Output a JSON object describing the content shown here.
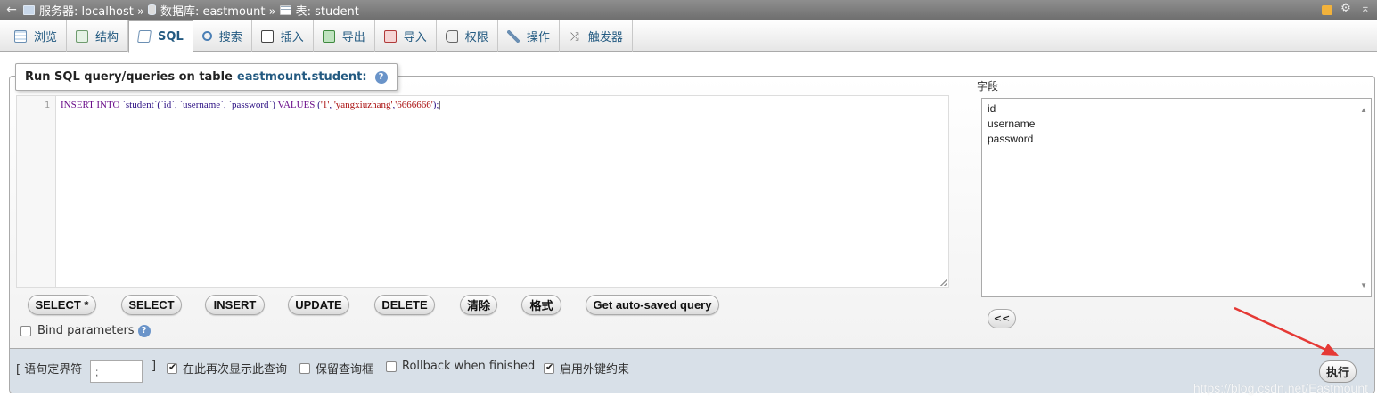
{
  "breadcrumb": {
    "back_symbol": "←",
    "server_label": "服务器: localhost »",
    "database_label": "数据库: eastmount »",
    "table_label": "表: student"
  },
  "tabs": [
    {
      "label": "浏览",
      "icon": "browse-icon"
    },
    {
      "label": "结构",
      "icon": "structure-icon"
    },
    {
      "label": "SQL",
      "icon": "sql-icon",
      "active": true
    },
    {
      "label": "搜索",
      "icon": "search-icon"
    },
    {
      "label": "插入",
      "icon": "insert-icon"
    },
    {
      "label": "导出",
      "icon": "export-icon"
    },
    {
      "label": "导入",
      "icon": "import-icon"
    },
    {
      "label": "权限",
      "icon": "privileges-icon"
    },
    {
      "label": "操作",
      "icon": "operations-icon"
    },
    {
      "label": "触发器",
      "icon": "triggers-icon"
    }
  ],
  "query_panel": {
    "title_prefix": "Run SQL query/queries on table",
    "table_name": "eastmount.student:",
    "line_number": "1",
    "sql_keyword_1": "INSERT INTO",
    "sql_part_1": " `student`(`id`, `username`, `password`) ",
    "sql_keyword_2": "VALUES",
    "sql_part_2": " (",
    "sql_str_1": "'1'",
    "sql_part_3": ", ",
    "sql_str_2": "'yangxiuzhang'",
    "sql_part_4": ",",
    "sql_str_3": "'6666666'",
    "sql_part_5": ");"
  },
  "fields": {
    "label": "字段",
    "items": [
      "id",
      "username",
      "password"
    ],
    "move_button": "<<"
  },
  "buttons": {
    "select_star": "SELECT *",
    "select": "SELECT",
    "insert": "INSERT",
    "update": "UPDATE",
    "delete": "DELETE",
    "clear": "清除",
    "format": "格式",
    "get_autosaved": "Get auto-saved query"
  },
  "bind_parameters": {
    "label": "Bind parameters",
    "checked": false
  },
  "footer": {
    "delimiter_label": "[ 语句定界符",
    "delimiter_value": ";",
    "delimiter_close": "]",
    "show_again_label": "在此再次显示此查询",
    "show_again_checked": true,
    "keep_box_label": "保留查询框",
    "keep_box_checked": false,
    "rollback_label": "Rollback when finished",
    "rollback_checked": false,
    "foreign_keys_label": "启用外键约束",
    "foreign_keys_checked": true,
    "execute_label": "执行"
  },
  "watermark": "https://blog.csdn.net/Eastmount",
  "colors": {
    "accent_link": "#235a81",
    "annotation_arrow": "#e53935"
  }
}
